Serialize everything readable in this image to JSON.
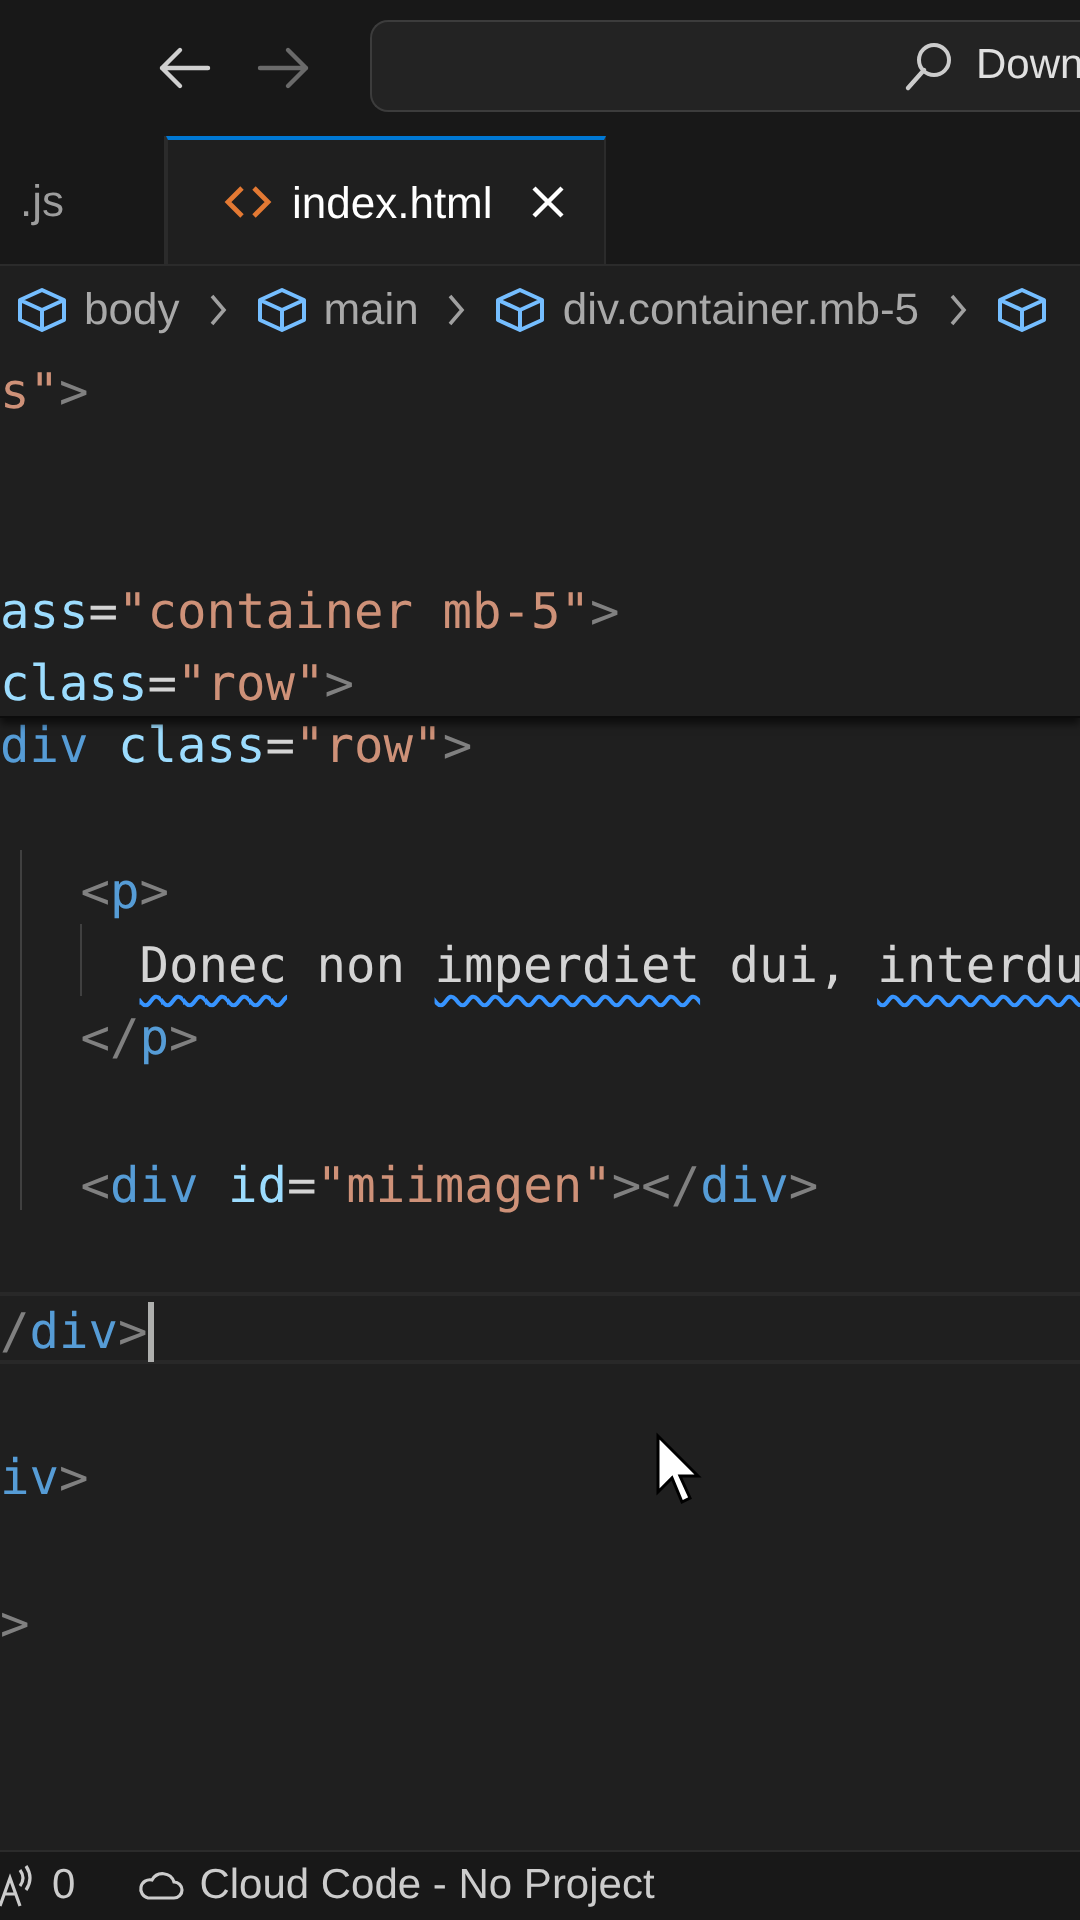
{
  "toolbar": {
    "back_enabled": true,
    "forward_enabled": false,
    "search": {
      "value": "Down"
    }
  },
  "tabs": [
    {
      "label": ".js",
      "selected": false,
      "kind": "js"
    },
    {
      "label": "index.html",
      "selected": true,
      "kind": "html"
    }
  ],
  "breadcrumbs": [
    "body",
    "main",
    "div.container.mb-5"
  ],
  "sticky_lines": [
    {
      "kind": "code",
      "current": false,
      "tokens": [
        {
          "t": "s\"",
          "kind": "string",
          "squiggle": false
        },
        {
          "t": ">",
          "kind": "punct",
          "squiggle": false
        }
      ]
    },
    {
      "kind": "blank"
    },
    {
      "kind": "blank"
    },
    {
      "kind": "code",
      "current": false,
      "tokens": [
        {
          "t": "ass",
          "kind": "attr",
          "squiggle": false
        },
        {
          "t": "=",
          "kind": "text",
          "squiggle": false
        },
        {
          "t": "\"container mb-5\"",
          "kind": "string",
          "squiggle": false
        },
        {
          "t": ">",
          "kind": "punct",
          "squiggle": false
        }
      ]
    },
    {
      "kind": "code",
      "current": false,
      "tokens": [
        {
          "t": "class",
          "kind": "attr",
          "squiggle": false
        },
        {
          "t": "=",
          "kind": "text",
          "squiggle": false
        },
        {
          "t": "\"row\"",
          "kind": "string",
          "squiggle": false
        },
        {
          "t": ">",
          "kind": "punct",
          "squiggle": false
        }
      ]
    }
  ],
  "lines": [
    {
      "kind": "code",
      "current": false,
      "tokens": [
        {
          "t": "div",
          "kind": "tag",
          "squiggle": false
        },
        {
          "t": " class",
          "kind": "attr",
          "squiggle": false
        },
        {
          "t": "=",
          "kind": "text",
          "squiggle": false
        },
        {
          "t": "\"row\"",
          "kind": "string",
          "squiggle": false
        },
        {
          "t": ">",
          "kind": "punct",
          "squiggle": false
        }
      ]
    },
    {
      "kind": "blank"
    },
    {
      "kind": "code",
      "current": false,
      "tokens": [
        {
          "t": "   <",
          "kind": "punct",
          "squiggle": false
        },
        {
          "t": "p",
          "kind": "tag",
          "squiggle": false
        },
        {
          "t": ">",
          "kind": "punct",
          "squiggle": false
        }
      ]
    },
    {
      "kind": "code",
      "current": false,
      "tokens": [
        {
          "t": "     Donec",
          "kind": "text",
          "squiggle": true
        },
        {
          "t": " non ",
          "kind": "text",
          "squiggle": false
        },
        {
          "t": "imperdiet",
          "kind": "text",
          "squiggle": true
        },
        {
          "t": " dui, ",
          "kind": "text",
          "squiggle": false
        },
        {
          "t": "interdu",
          "kind": "text",
          "squiggle": true
        }
      ]
    },
    {
      "kind": "code",
      "current": false,
      "tokens": [
        {
          "t": "   </",
          "kind": "punct",
          "squiggle": false
        },
        {
          "t": "p",
          "kind": "tag",
          "squiggle": false
        },
        {
          "t": ">",
          "kind": "punct",
          "squiggle": false
        }
      ]
    },
    {
      "kind": "blank"
    },
    {
      "kind": "code",
      "current": false,
      "tokens": [
        {
          "t": "   <",
          "kind": "punct",
          "squiggle": false
        },
        {
          "t": "div",
          "kind": "tag",
          "squiggle": false
        },
        {
          "t": " id",
          "kind": "attr",
          "squiggle": false
        },
        {
          "t": "=",
          "kind": "text",
          "squiggle": false
        },
        {
          "t": "\"miimagen\"",
          "kind": "string",
          "squiggle": false
        },
        {
          "t": "></",
          "kind": "punct",
          "squiggle": false
        },
        {
          "t": "div",
          "kind": "tag",
          "squiggle": false
        },
        {
          "t": ">",
          "kind": "punct",
          "squiggle": false
        }
      ]
    },
    {
      "kind": "blank"
    },
    {
      "kind": "code",
      "current": true,
      "tokens": [
        {
          "t": "/",
          "kind": "punct",
          "squiggle": false
        },
        {
          "t": "div",
          "kind": "tag",
          "squiggle": false
        },
        {
          "t": ">",
          "kind": "punct",
          "squiggle": false
        }
      ]
    },
    {
      "kind": "blank"
    },
    {
      "kind": "code",
      "current": false,
      "tokens": [
        {
          "t": "iv",
          "kind": "tag",
          "squiggle": false
        },
        {
          "t": ">",
          "kind": "punct",
          "squiggle": false
        }
      ]
    },
    {
      "kind": "blank"
    },
    {
      "kind": "code",
      "current": false,
      "tokens": [
        {
          "t": ">",
          "kind": "punct",
          "squiggle": false
        }
      ]
    }
  ],
  "status_bar": {
    "ports": "0",
    "cloud": "Cloud Code - No Project"
  }
}
